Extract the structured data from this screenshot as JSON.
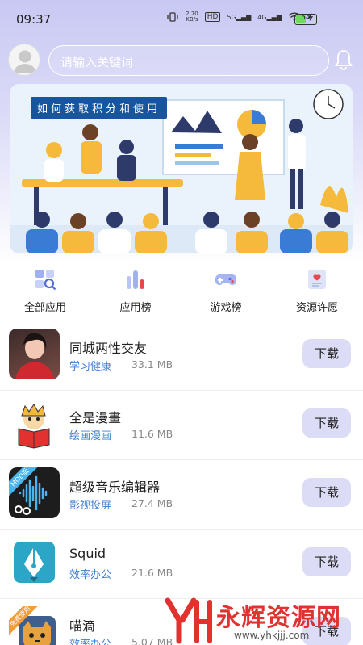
{
  "status": {
    "time": "09:37",
    "net_speed_value": "2.70",
    "net_speed_unit": "KB/s",
    "hd_label": "HD",
    "sig1": "5G",
    "sig2": "4G",
    "battery": "54",
    "battery_pct": 54
  },
  "search": {
    "placeholder": "请输入关键词"
  },
  "banner": {
    "title": "如何获取积分和使用"
  },
  "categories": [
    {
      "label": "全部应用",
      "icon": "grid-search-icon"
    },
    {
      "label": "应用榜",
      "icon": "bar-chart-icon"
    },
    {
      "label": "游戏榜",
      "icon": "gamepad-icon"
    },
    {
      "label": "资源许愿",
      "icon": "heart-card-icon"
    }
  ],
  "apps": [
    {
      "name": "同城两性交友",
      "category": "学习健康",
      "size": "33.1 MB",
      "button": "下载",
      "icon": "portrait-photo-icon"
    },
    {
      "name": "全是漫畫",
      "category": "绘画漫画",
      "size": "11.6 MB",
      "button": "下载",
      "icon": "comic-reader-icon"
    },
    {
      "name": "超级音乐编辑器",
      "category": "影视投屏",
      "size": "27.4 MB",
      "button": "下载",
      "icon": "audio-wave-scissors-icon",
      "badge": "MOD版"
    },
    {
      "name": "Squid",
      "category": "效率办公",
      "size": "21.6 MB",
      "button": "下载",
      "icon": "pen-nib-icon"
    },
    {
      "name": "喵滴",
      "category": "效率办公",
      "size": "5.07 MB",
      "button": "下载",
      "icon": "cat-face-icon",
      "badge": "免费使用"
    }
  ],
  "watermark": {
    "text": "永辉资源网",
    "url": "www.yhkjjj.com"
  },
  "colors": {
    "accent": "#3f7ed6",
    "button_bg": "#dcdcf6",
    "banner_title_bg": "#17569e",
    "watermark": "#e2322f"
  }
}
